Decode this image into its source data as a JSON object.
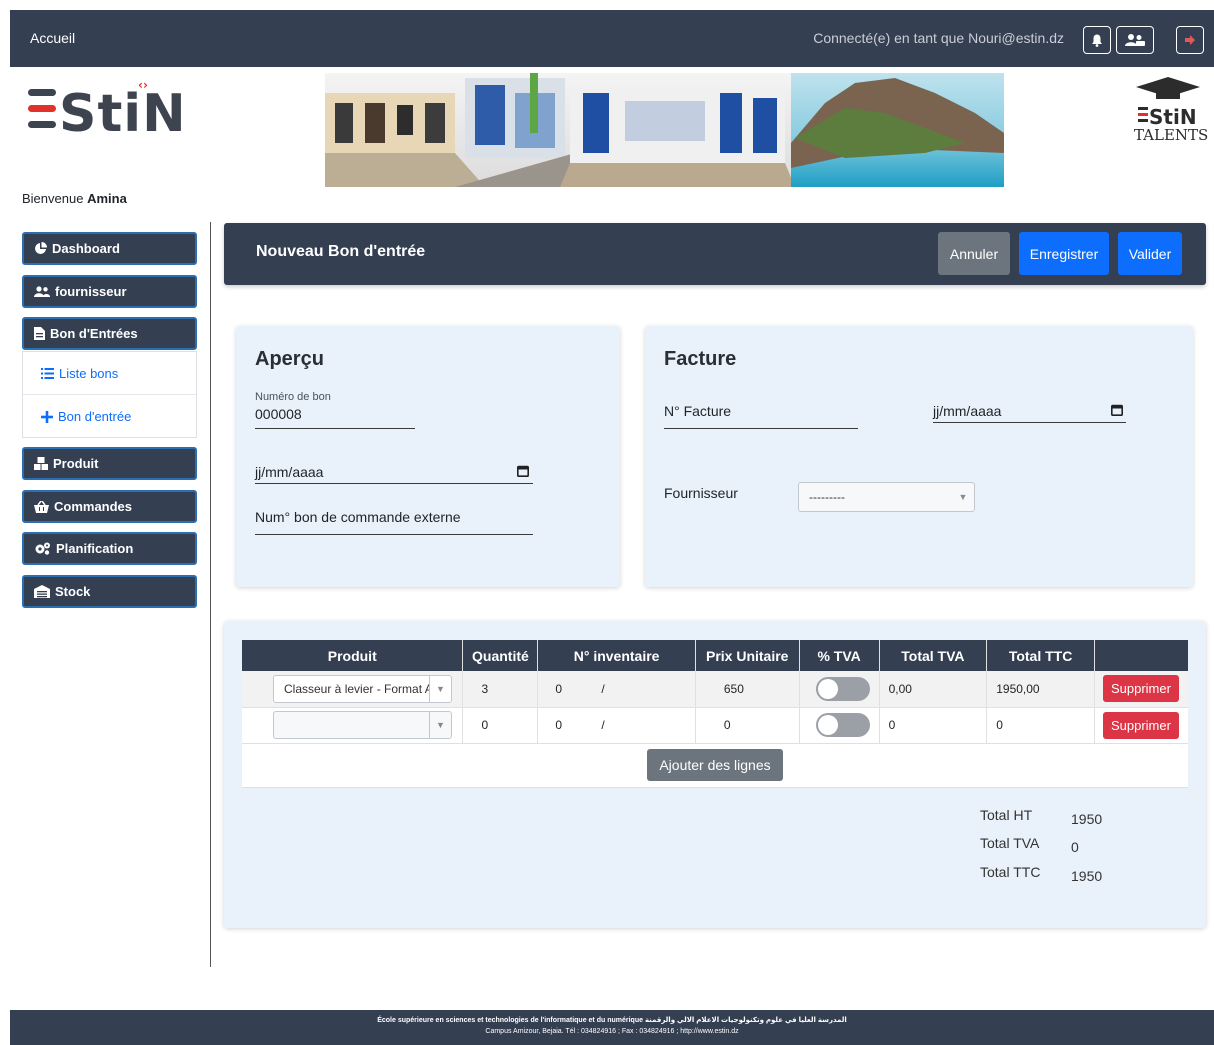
{
  "topnav": {
    "home": "Accueil",
    "user_text": "Connecté(e) en tant que Nouri@estin.dz",
    "icons": [
      "bell-icon",
      "users-icon",
      "logout-icon"
    ]
  },
  "header": {
    "logo_text": "ESTIN",
    "talents_logo": "ESTIN TALENTS",
    "welcome_prefix": "Bienvenue",
    "welcome_name": "Amina"
  },
  "sidebar": {
    "items": [
      {
        "label": "Dashboard",
        "icon": "chart-pie-icon"
      },
      {
        "label": "fournisseur",
        "icon": "users-icon"
      },
      {
        "label": "Bon d'Entrées",
        "icon": "file-icon"
      },
      {
        "label": "Produit",
        "icon": "boxes-icon"
      },
      {
        "label": "Commandes",
        "icon": "basket-icon"
      },
      {
        "label": "Planification",
        "icon": "cogs-icon"
      },
      {
        "label": "Stock",
        "icon": "warehouse-icon"
      }
    ],
    "sub": [
      {
        "label": "Liste bons",
        "icon": "list-icon"
      },
      {
        "label": "Bon d'entrée",
        "icon": "plus-icon"
      }
    ]
  },
  "page": {
    "title": "Nouveau Bon d'entrée",
    "buttons": {
      "cancel": "Annuler",
      "save": "Enregistrer",
      "validate": "Valider"
    }
  },
  "apercu": {
    "title": "Aperçu",
    "num_label": "Numéro de bon",
    "num_value": "000008",
    "date_placeholder": "jj/mm/aaaa",
    "ext_order_label": "Num° bon de commande externe"
  },
  "facture": {
    "title": "Facture",
    "num_label": "N° Facture",
    "date_placeholder": "jj/mm/aaaa",
    "supplier_label": "Fournisseur",
    "supplier_value": "---------"
  },
  "table": {
    "headers": [
      "Produit",
      "Quantité",
      "N° inventaire",
      "Prix Unitaire",
      "% TVA",
      "Total TVA",
      "Total TTC",
      ""
    ],
    "rows": [
      {
        "product": "Classeur à levier - Format A",
        "qty": "3",
        "inv_a": "0",
        "inv_sep": "/",
        "price": "650",
        "tva_on": false,
        "total_tva": "0,00",
        "total_ttc": "1950,00",
        "delete": "Supprimer"
      },
      {
        "product": "",
        "qty": "0",
        "inv_a": "0",
        "inv_sep": "/",
        "price": "0",
        "tva_on": false,
        "total_tva": "0",
        "total_ttc": "0",
        "delete": "Supprimer"
      }
    ],
    "add_lines": "Ajouter des lignes"
  },
  "totals": {
    "ht_label": "Total HT",
    "ht_value": "1950",
    "tva_label": "Total TVA",
    "tva_value": "0",
    "ttc_label": "Total TTC",
    "ttc_value": "1950"
  },
  "footer": {
    "line1": "École supérieure en sciences et technologies de l'informatique et du numérique المدرسة العليا في علوم وتكنولوجيات الاعلام الالي والرقمنة",
    "line2": "Campus Amizour, Bejaia. Tél : 034824916 ; Fax : 034824916 ; http://www.estin.dz"
  },
  "colors": {
    "navy": "#343f52",
    "primary": "#0d6efd",
    "danger": "#dc3545",
    "secondary": "#6c757d",
    "card_bg": "#e9f2fb"
  }
}
